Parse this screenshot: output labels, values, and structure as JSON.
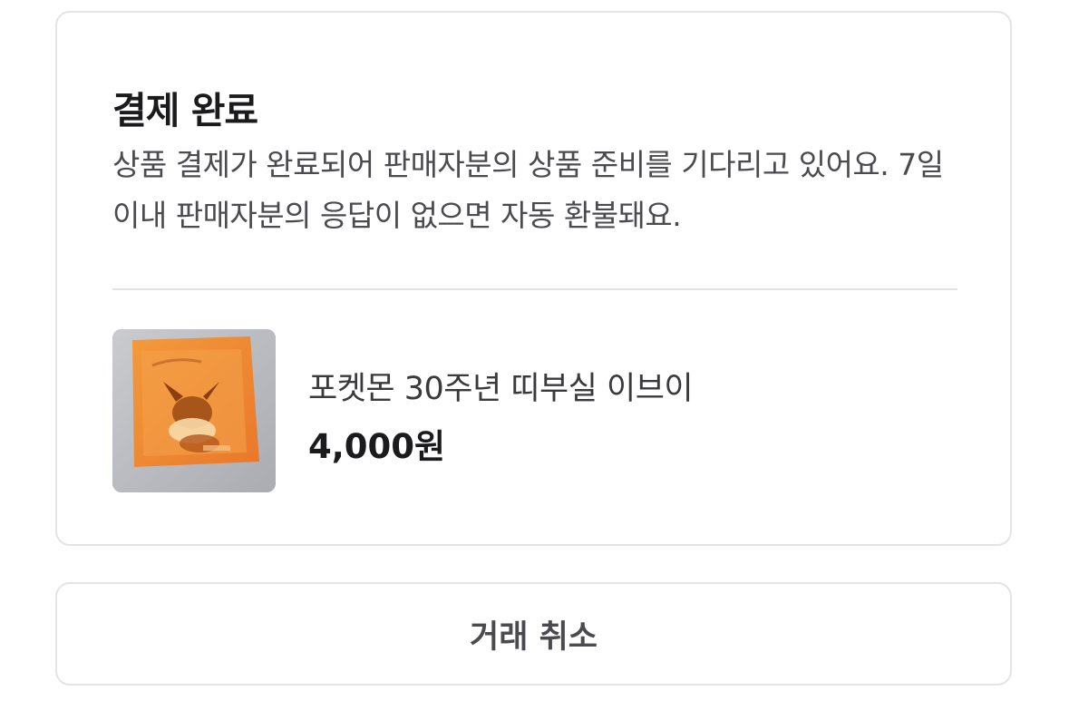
{
  "status_card": {
    "title": "결제 완료",
    "description": "상품 결제가 완료되어 판매자분의 상품 준비를 기다리고 있어요. 7일 이내 판매자분의 응답이 없으면 자동 환불돼요."
  },
  "product": {
    "name": "포켓몬 30주년 띠부실 이브이",
    "price": "4,000원",
    "image_icon": "eevee-sticker-photo"
  },
  "actions": {
    "cancel_label": "거래 취소"
  },
  "colors": {
    "border": "#e4e4e6",
    "title_text": "#1b1b1d",
    "body_text": "#4b4b4f",
    "sticker_orange": "#f08a2c"
  }
}
